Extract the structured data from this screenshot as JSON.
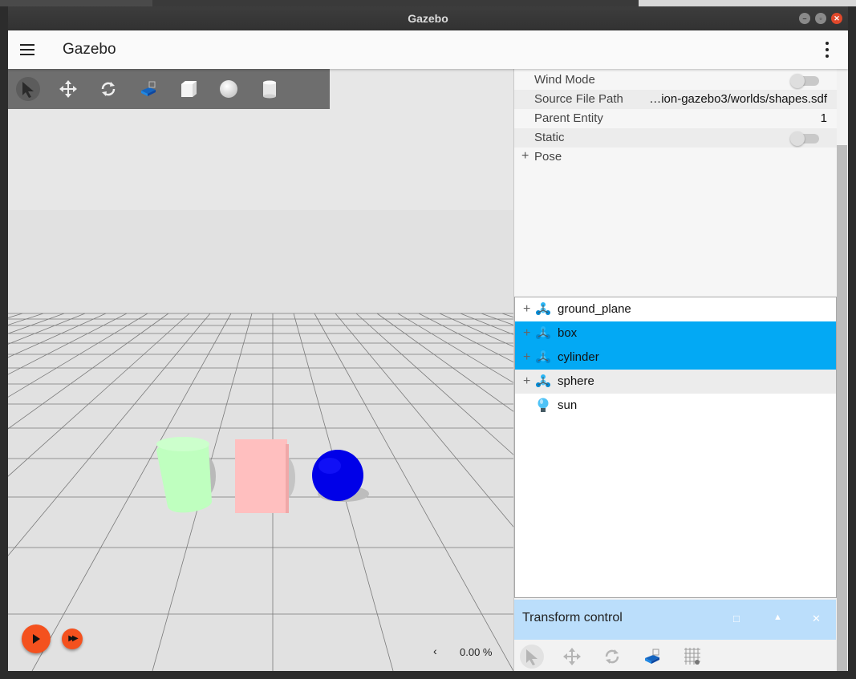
{
  "window": {
    "title": "Gazebo"
  },
  "appbar": {
    "title": "Gazebo"
  },
  "scene_toolbar": {
    "tools": [
      {
        "icon": "select-arrow-icon"
      },
      {
        "icon": "translate-icon"
      },
      {
        "icon": "rotate-icon"
      },
      {
        "icon": "transform-control-icon"
      },
      {
        "icon": "box-shape-icon"
      },
      {
        "icon": "sphere-shape-icon"
      },
      {
        "icon": "cylinder-shape-icon"
      }
    ]
  },
  "scene": {
    "objects": [
      {
        "name": "cylinder",
        "color": "#bfffbf"
      },
      {
        "name": "box",
        "color": "#ffbfbf"
      },
      {
        "name": "sphere",
        "color": "#0000ff"
      }
    ]
  },
  "playback": {
    "rtf_arrow": "‹",
    "rtf_value": "0.00 %"
  },
  "component_inspector": {
    "rows": [
      {
        "label": "Wind Mode",
        "type": "toggle",
        "value": false
      },
      {
        "label": "Source File Path",
        "type": "text",
        "value": "…ion-gazebo3/worlds/shapes.sdf"
      },
      {
        "label": "Parent Entity",
        "type": "text",
        "value": "1"
      },
      {
        "label": "Static",
        "type": "toggle",
        "value": false
      }
    ],
    "pose_label": "Pose",
    "pose_expander": "+"
  },
  "entity_tree": {
    "items": [
      {
        "label": "ground_plane",
        "expander": "+",
        "icon": "model-icon",
        "selected": false
      },
      {
        "label": "box",
        "expander": "+",
        "icon": "model-icon",
        "selected": true
      },
      {
        "label": "cylinder",
        "expander": "+",
        "icon": "model-icon",
        "selected": true
      },
      {
        "label": "sphere",
        "expander": "+",
        "icon": "model-icon",
        "selected": false
      },
      {
        "label": "sun",
        "expander": "",
        "icon": "light-bulb-icon",
        "selected": false
      }
    ]
  },
  "transform_control": {
    "title": "Transform control",
    "restore_glyph": "□",
    "collapse_glyph": "▲",
    "close_glyph": "✕",
    "tools": [
      {
        "icon": "select-arrow-icon"
      },
      {
        "icon": "translate-icon"
      },
      {
        "icon": "rotate-icon"
      },
      {
        "icon": "transform-control-icon"
      },
      {
        "icon": "snap-grid-icon"
      }
    ]
  },
  "colors": {
    "accent_orange": "#f4511e",
    "selection_blue": "#03a9f4",
    "panel_header_blue": "#bbdefb"
  }
}
